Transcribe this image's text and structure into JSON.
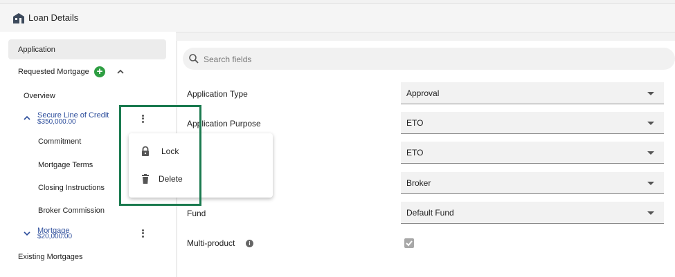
{
  "header": {
    "title": "Loan Details",
    "icon": "building-icon"
  },
  "sidebar": {
    "application": "Application",
    "requested_mortgage": "Requested Mortgage",
    "overview": "Overview",
    "secure_line": {
      "title": "Secure Line of Credit",
      "amount": "$350,000.00"
    },
    "sub_items": [
      "Commitment",
      "Mortgage Terms",
      "Closing Instructions",
      "Broker Commission"
    ],
    "mortgage": {
      "title": "Mortgage",
      "amount": "$20,000.00"
    },
    "existing_mortgages": "Existing Mortgages"
  },
  "search": {
    "placeholder": "Search fields"
  },
  "fields": [
    {
      "label": "Application Type",
      "value": "Approval"
    },
    {
      "label": "Application Purpose",
      "value": "ETO"
    },
    {
      "label": "",
      "value": "ETO"
    },
    {
      "label": "",
      "value": "Broker"
    },
    {
      "label": "Fund",
      "value": "Default Fund"
    }
  ],
  "multi_product": {
    "label": "Multi-product",
    "checked": true
  },
  "context_menu": {
    "lock": "Lock",
    "delete": "Delete"
  },
  "colors": {
    "accent_green": "#2e9e42",
    "highlight": "#1a7a4f",
    "link_blue": "#2b4c9b"
  }
}
